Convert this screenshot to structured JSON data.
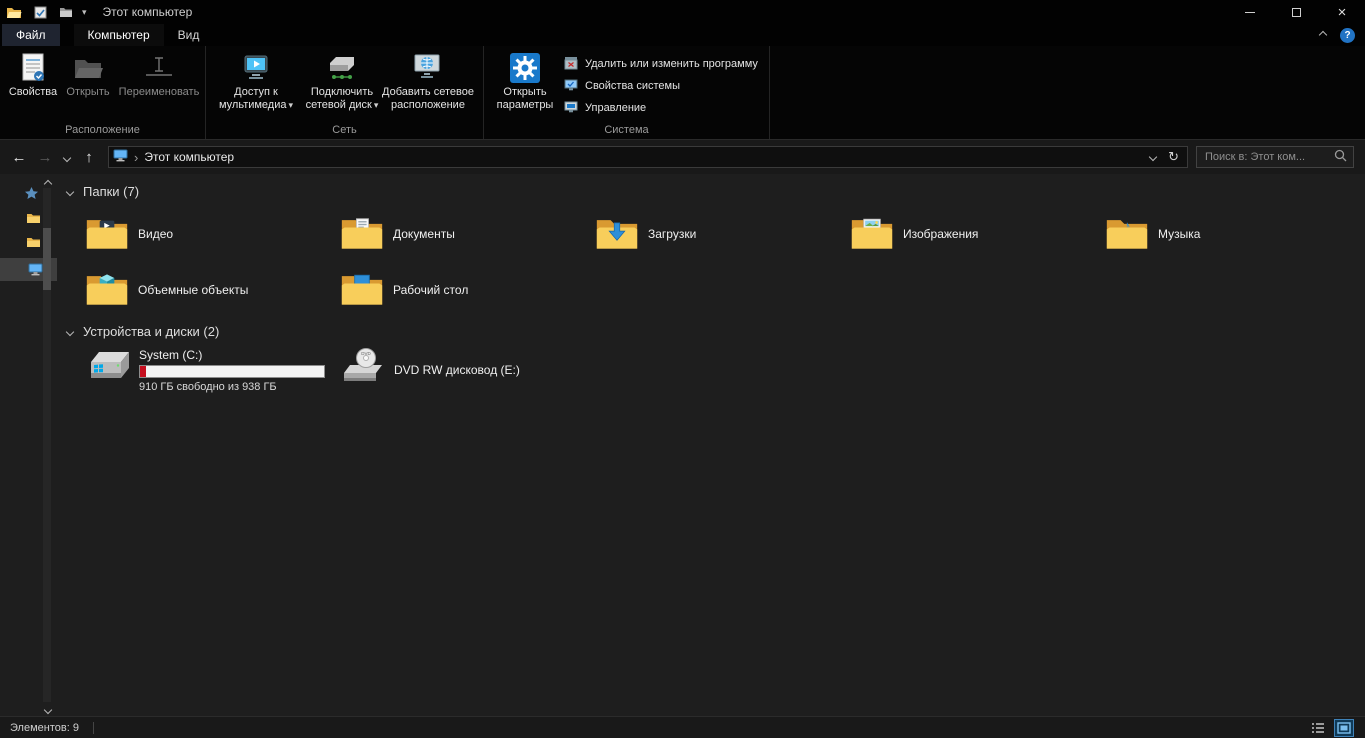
{
  "colors": {
    "accent_blue": "#0078d7",
    "folder_yellow": "#f8ce5b",
    "drive_used": "#c50f1f",
    "selection_gray": "#3f3f3f"
  },
  "icons": {
    "back": "←",
    "forward": "→",
    "up": "↑",
    "refresh": "↻",
    "dropdown": "▾",
    "breadcrumb_chevron": "›",
    "close": "×",
    "help": "?",
    "dvd_label": "DVD",
    "music_note": "♪"
  },
  "titlebar": {
    "title": "Этот компьютер"
  },
  "tabs": {
    "file": "Файл",
    "computer": "Компьютер",
    "view": "Вид"
  },
  "ribbon": {
    "location_group": {
      "label": "Расположение",
      "properties": "Свойства",
      "open": "Открыть",
      "rename": "Переименовать"
    },
    "network_group": {
      "label": "Сеть",
      "media_access": "Доступ к мультимедиа",
      "map_drive": "Подключить сетевой диск",
      "add_location": "Добавить сетевое расположение"
    },
    "system_group": {
      "label": "Система",
      "open_settings": "Открыть параметры",
      "uninstall": "Удалить или изменить программу",
      "system_properties": "Свойства системы",
      "manage": "Управление"
    }
  },
  "address": {
    "breadcrumb": "Этот компьютер",
    "search_placeholder": "Поиск в: Этот ком..."
  },
  "content": {
    "folders_header": "Папки (7)",
    "folders": [
      {
        "name": "Видео"
      },
      {
        "name": "Документы"
      },
      {
        "name": "Загрузки"
      },
      {
        "name": "Изображения"
      },
      {
        "name": "Музыка"
      },
      {
        "name": "Объемные объекты"
      },
      {
        "name": "Рабочий стол"
      }
    ],
    "devices_header": "Устройства и диски (2)",
    "drives": [
      {
        "name": "System (C:)",
        "free_text": "910 ГБ свободно из 938 ГБ",
        "used_percent": 3
      },
      {
        "name": "DVD RW дисковод (E:)"
      }
    ]
  },
  "statusbar": {
    "items_count": "Элементов: 9"
  }
}
